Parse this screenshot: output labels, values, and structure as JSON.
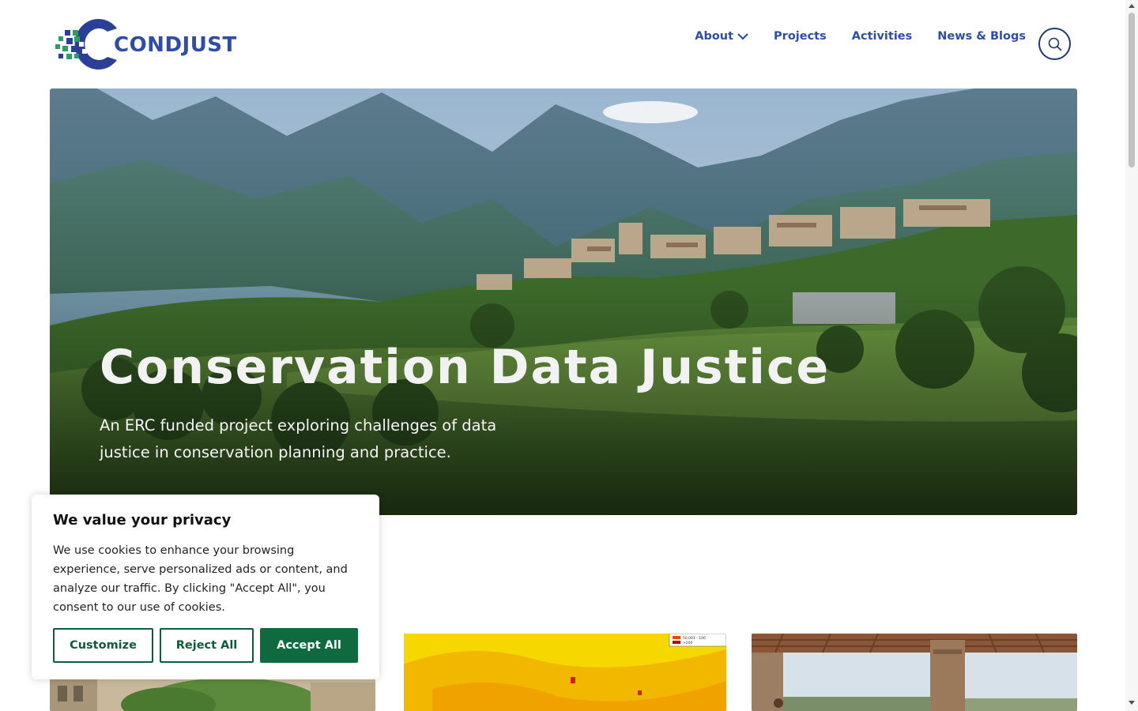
{
  "site": {
    "logo_text": "CONDJUST"
  },
  "nav": {
    "items": [
      {
        "label": "About",
        "has_dropdown": true
      },
      {
        "label": "Projects"
      },
      {
        "label": "Activities"
      },
      {
        "label": "News & Blogs"
      }
    ],
    "search_icon": "search-icon"
  },
  "hero": {
    "title": "Conservation Data Justice",
    "subtitle": "An ERC funded project exploring challenges of data justice in conservation planning and practice."
  },
  "cards": {
    "card2_legend": [
      "50,001 - 100",
      ">200"
    ]
  },
  "cookie": {
    "title": "We value your privacy",
    "text": "We use cookies to enhance your browsing experience, serve personalized ads or content, and analyze our traffic. By clicking \"Accept All\", you consent to our use of cookies.",
    "customize": "Customize",
    "reject": "Reject All",
    "accept": "Accept All"
  },
  "colors": {
    "brand_blue": "#2f4ea3",
    "accept_green": "#0f6b3f",
    "logo_green": "#2f9a6a"
  }
}
